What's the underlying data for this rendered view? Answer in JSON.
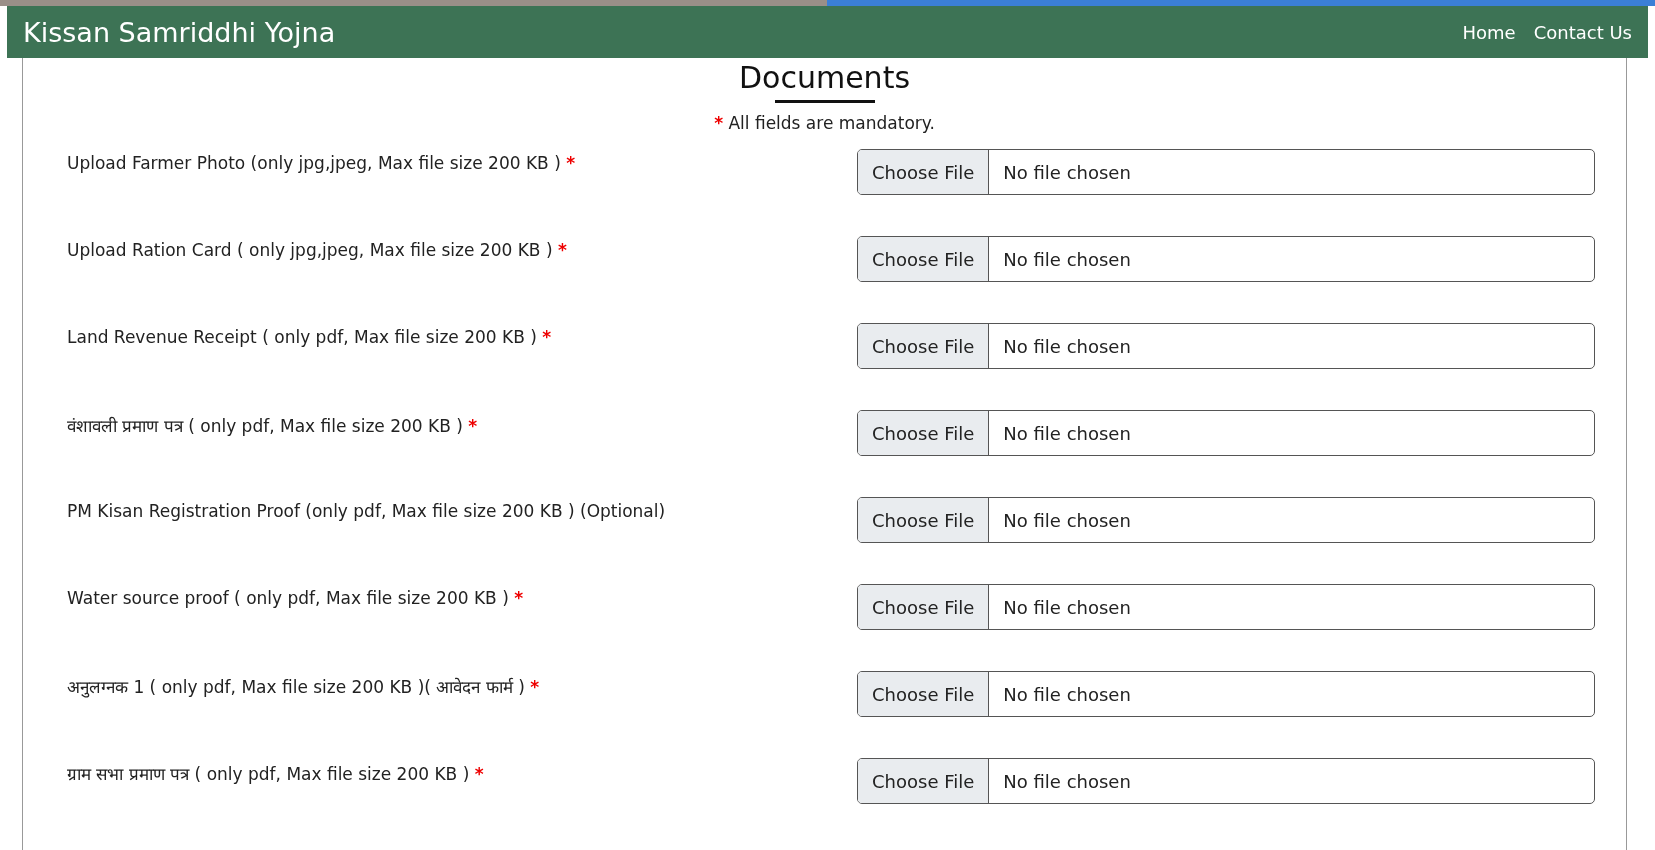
{
  "navbar": {
    "brand": "Kissan Samriddhi Yojna",
    "links": [
      {
        "label": "Home"
      },
      {
        "label": "Contact Us"
      }
    ]
  },
  "section": {
    "title": "Documents",
    "note_mark": "*",
    "note": "All fields are mandatory."
  },
  "fields": [
    {
      "label": "Upload Farmer Photo (only jpg,jpeg, Max file size 200 KB )",
      "required": true,
      "button": "Choose File",
      "status": "No file chosen"
    },
    {
      "label": "Upload Ration Card ( only jpg,jpeg, Max file size 200 KB )",
      "required": true,
      "button": "Choose File",
      "status": "No file chosen"
    },
    {
      "label": "Land Revenue Receipt ( only pdf, Max file size 200 KB )",
      "required": true,
      "button": "Choose File",
      "status": "No file chosen"
    },
    {
      "label": "वंशावली प्रमाण पत्र ( only pdf, Max file size 200 KB )",
      "required": true,
      "button": "Choose File",
      "status": "No file chosen"
    },
    {
      "label": "PM Kisan Registration Proof (only pdf, Max file size 200 KB ) (Optional)",
      "required": false,
      "button": "Choose File",
      "status": "No file chosen"
    },
    {
      "label": "Water source proof ( only pdf, Max file size 200 KB )",
      "required": true,
      "button": "Choose File",
      "status": "No file chosen"
    },
    {
      "label": "अनुलग्नक 1 ( only pdf, Max file size 200 KB )( आवेदन फार्म )",
      "required": true,
      "button": "Choose File",
      "status": "No file chosen"
    },
    {
      "label": "ग्राम सभा प्रमाण पत्र ( only pdf, Max file size 200 KB )",
      "required": true,
      "button": "Choose File",
      "status": "No file chosen"
    }
  ]
}
